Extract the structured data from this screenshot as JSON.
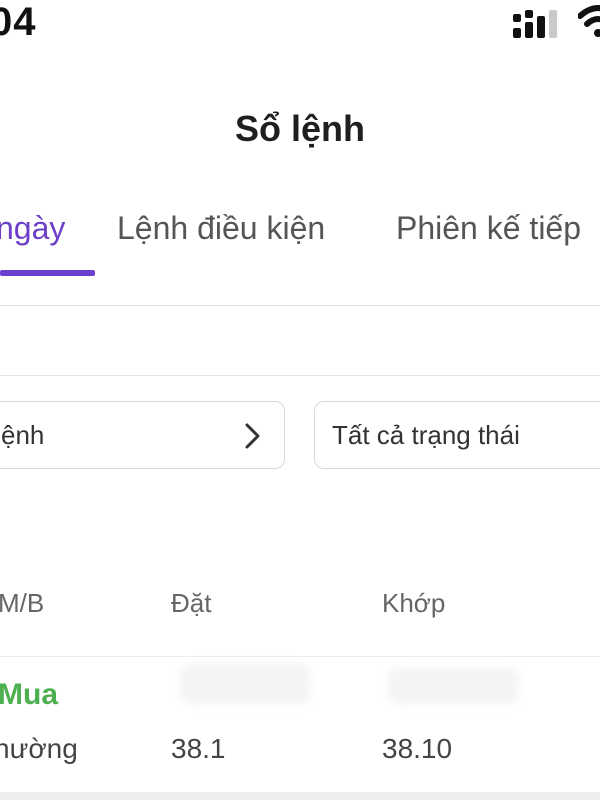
{
  "status_bar": {
    "time": "04",
    "signal_icon": "cellular-signal-icon",
    "wifi_icon": "wifi-icon"
  },
  "header": {
    "title": "Sổ lệnh"
  },
  "tabs": [
    {
      "label": "ngày",
      "active": true
    },
    {
      "label": "Lệnh điều kiện",
      "active": false
    },
    {
      "label": "Phiên kế tiếp",
      "active": false
    }
  ],
  "filters": {
    "order_type": "ệnh",
    "status": "Tất cả trạng thái",
    "chevron_icon": "chevron-right-icon"
  },
  "table": {
    "headers": [
      "M/B",
      "Đặt",
      "Khớp"
    ],
    "rows": [
      {
        "side": "Mua",
        "type": "hường",
        "dat": "38.1",
        "khop": "38.10"
      }
    ]
  },
  "colors": {
    "accent": "#6b3fcf",
    "buy": "#4caf50"
  }
}
